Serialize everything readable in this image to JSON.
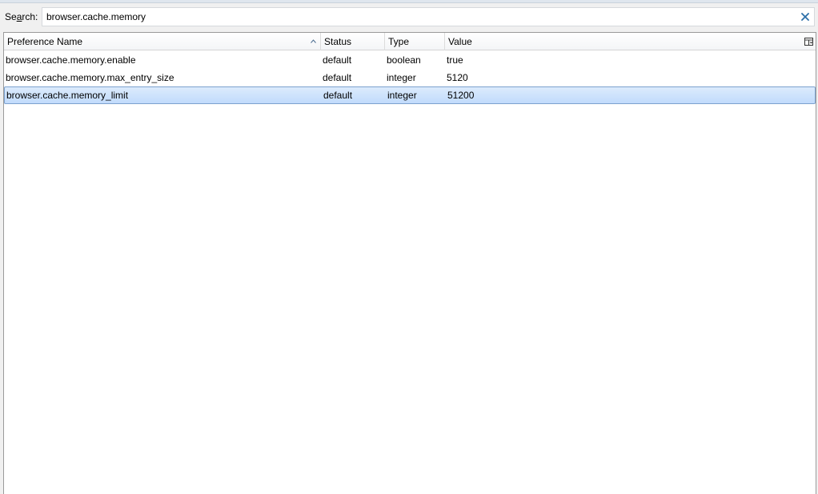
{
  "search": {
    "label_prefix": "Se",
    "label_accel": "a",
    "label_suffix": "rch:",
    "value": "browser.cache.memory"
  },
  "columns": {
    "name": "Preference Name",
    "status": "Status",
    "type": "Type",
    "value": "Value"
  },
  "rows": [
    {
      "name": "browser.cache.memory.enable",
      "status": "default",
      "type": "boolean",
      "value": "true",
      "selected": false
    },
    {
      "name": "browser.cache.memory.max_entry_size",
      "status": "default",
      "type": "integer",
      "value": "5120",
      "selected": false
    },
    {
      "name": "browser.cache.memory_limit",
      "status": "default",
      "type": "integer",
      "value": "51200",
      "selected": true
    }
  ],
  "icons": {
    "clear": "close-icon",
    "sort": "sort-ascending-icon",
    "column_picker": "column-picker-icon"
  },
  "colors": {
    "selection": "#c1dbfc",
    "selection_border": "#7da2ce",
    "clear_icon": "#2c6fa8"
  }
}
